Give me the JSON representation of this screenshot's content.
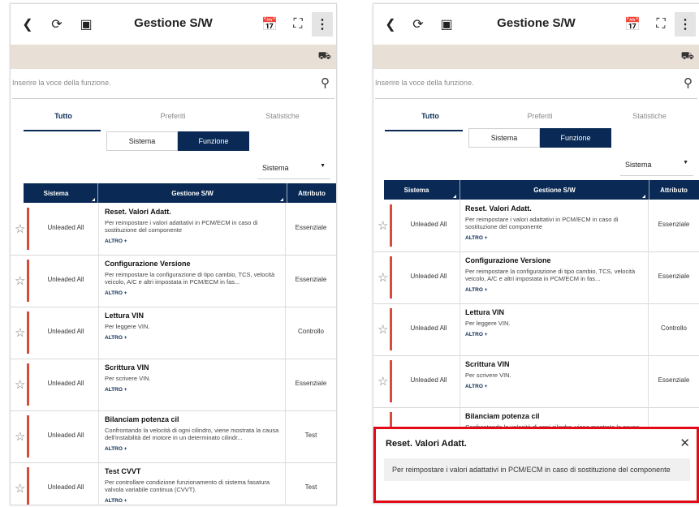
{
  "header": {
    "title": "Gestione S/W",
    "back_icon": "chevron-left-icon",
    "sync_icon": "sync-settings-icon",
    "image_icon": "image-add-icon",
    "calendar_icon": "calendar-icon",
    "fullscreen_icon": "fullscreen-icon",
    "more_icon": "more-vertical-icon",
    "car_icon": "car-icon"
  },
  "search": {
    "placeholder": "Inserire la voce della funzione."
  },
  "tabs": [
    {
      "label": "Tutto",
      "active": true
    },
    {
      "label": "Preferiti",
      "active": false
    },
    {
      "label": "Statistiche",
      "active": false
    }
  ],
  "segment": {
    "options": [
      "Sistema",
      "Funzione"
    ],
    "selected": "Funzione"
  },
  "dropdown": {
    "value": "Sistema"
  },
  "table": {
    "headers": [
      "Sistema",
      "Gestione S/W",
      "Attributo"
    ],
    "more_label": "ALTRO +",
    "rows": [
      {
        "system": "Unleaded All",
        "title": "Reset. Valori Adatt.",
        "desc": "Per reimpostare i valori adattativi in PCM/ECM in caso di sostituzione del componente",
        "attr": "Essenziale"
      },
      {
        "system": "Unleaded All",
        "title": "Configurazione Versione",
        "desc": "Per reimpostare la configurazione di tipo cambio, TCS, velocità veicolo, A/C e altri impostata in PCM/ECM in fas...",
        "attr": "Essenziale"
      },
      {
        "system": "Unleaded All",
        "title": "Lettura VIN",
        "desc": "Per leggere VIN.",
        "attr": "Controllo"
      },
      {
        "system": "Unleaded All",
        "title": "Scrittura VIN",
        "desc": "Per scrivere VIN.",
        "attr": "Essenziale"
      },
      {
        "system": "Unleaded All",
        "title": "Bilanciam potenza cil",
        "desc": "Confrontando la velocità di ogni cilindro, viene mostrata la causa dell'instabilità del motore in un determinato cilindr...",
        "attr": "Test"
      },
      {
        "system": "Unleaded All",
        "title": "Test CVVT",
        "desc": "Per controllare condizione funzionamento di sistema fasatura valvola variabile continua (CVVT).",
        "attr": "Test"
      }
    ]
  },
  "detail_panel": {
    "title": "Reset. Valori Adatt.",
    "description": "Per reimpostare i valori adattativi in PCM/ECM in caso di sostituzione del componente",
    "close_icon": "close-icon"
  },
  "colors": {
    "navy": "#0a2a55",
    "red_bar": "#d64b3c",
    "highlight_border": "#e30a17",
    "band": "#e8dfd6"
  }
}
